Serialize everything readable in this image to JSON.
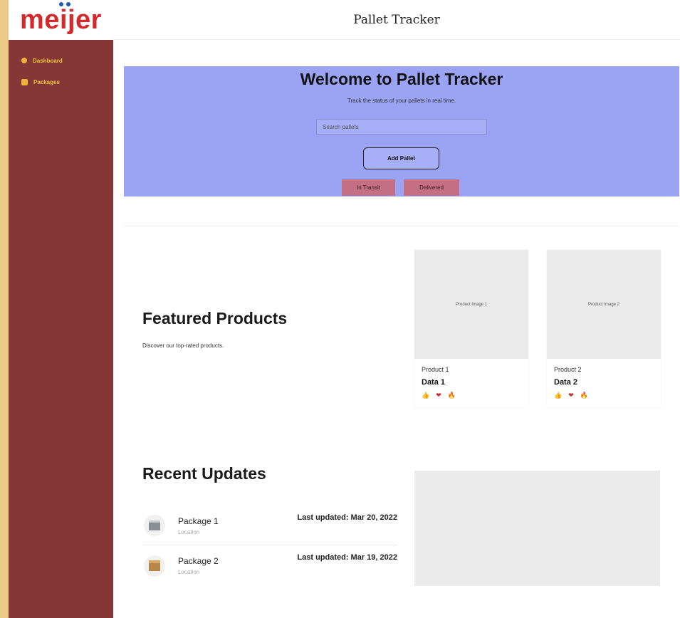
{
  "brand": {
    "logo_text": "meijer"
  },
  "sidebar": {
    "items": [
      {
        "label": "Dashboard",
        "icon": "dot-icon"
      },
      {
        "label": "Packages",
        "icon": "package-icon"
      }
    ]
  },
  "header": {
    "title": "Pallet Tracker"
  },
  "hero": {
    "title": "Welcome to Pallet Tracker",
    "subtitle": "Track the status of your pallets in real time.",
    "search_placeholder": "Search pallets",
    "add_label": "Add Pallet",
    "filter_in_transit": "In Transit",
    "filter_delivered": "Delivered"
  },
  "featured": {
    "title": "Featured Products",
    "description": "Discover our top-rated products.",
    "cards": [
      {
        "image_label": "Product Image 1",
        "name": "Product 1",
        "data": "Data 1"
      },
      {
        "image_label": "Product Image 2",
        "name": "Product 2",
        "data": "Data 2"
      }
    ]
  },
  "updates": {
    "title": "Recent Updates",
    "rows": [
      {
        "name": "Package 1",
        "location": "Location",
        "date": "Last updated: Mar 20, 2022"
      },
      {
        "name": "Package 2",
        "location": "Location",
        "date": "Last updated: Mar 19, 2022"
      }
    ]
  },
  "colors": {
    "sidebar": "#843735",
    "hero": "#9aa3f4",
    "logo": "#d32b2b",
    "filter_button": "#c46f83",
    "nav_text": "#f2c23c"
  }
}
